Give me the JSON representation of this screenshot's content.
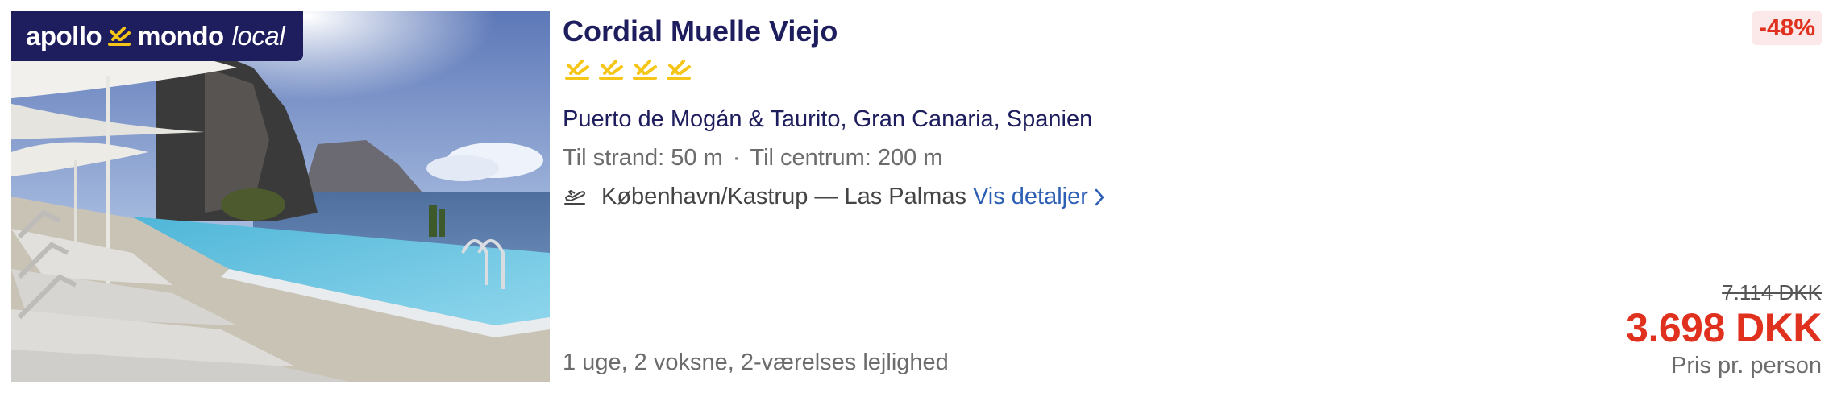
{
  "brand": {
    "name_left": "apollo",
    "name_right": "mondo",
    "name_suffix": "local",
    "logo_icon": "apollo-sun-icon",
    "background_color": "#1e1d5e"
  },
  "image": {
    "icon": "hotel-pool-photo"
  },
  "hotel": {
    "name": "Cordial Muelle Viejo",
    "rating": 4,
    "star_icon": "apollo-sun-star-icon",
    "star_color": "#f5c518",
    "location": "Puerto de Mogán & Taurito, Gran Canaria, Spanien",
    "beach_distance": "Til strand: 50 m",
    "separator": "·",
    "center_distance": "Til centrum: 200 m"
  },
  "flight": {
    "icon": "plane-takeoff-icon",
    "route": "København/Kastrup — Las Palmas",
    "details_link": "Vis detaljer",
    "link_color": "#2d5fb4"
  },
  "trip": {
    "info": "1 uge, 2 voksne, 2-værelses lejlighed"
  },
  "pricing": {
    "discount": "-48%",
    "old_price": "7.114 DKK",
    "price": "3.698 DKK",
    "price_note": "Pris pr. person",
    "accent_color": "#e0301e"
  }
}
